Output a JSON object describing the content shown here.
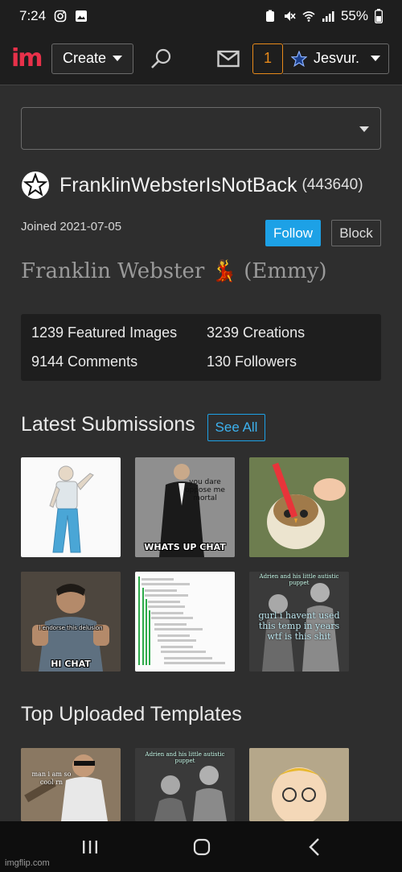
{
  "status_bar": {
    "time": "7:24",
    "battery": "55%"
  },
  "nav": {
    "logo": "im",
    "create_label": "Create",
    "notification_count": "1",
    "username": "Jesvur."
  },
  "profile": {
    "username": "FranklinWebsterIsNotBack",
    "user_id": "(443640)",
    "joined": "Joined 2021-07-05",
    "follow_label": "Follow",
    "block_label": "Block",
    "display_name": "Franklin Webster",
    "display_emoji": "💃",
    "display_suffix": "(Emmy)"
  },
  "stats": {
    "featured": "1239 Featured Images",
    "creations": "3239 Creations",
    "comments": "9144 Comments",
    "followers": "130 Followers"
  },
  "latest": {
    "title": "Latest Submissions",
    "see_all": "See All",
    "items": [
      {
        "caption": ""
      },
      {
        "caption": "WHATS UP CHAT",
        "top_text": "you dare oppose me mortal"
      },
      {
        "caption": ""
      },
      {
        "caption": "HI CHAT",
        "top_text": "i endorse this delusion"
      },
      {
        "caption": ""
      },
      {
        "caption": "gurl i havent used this temp in years wtf is this shit",
        "top_text": "Adrien and his little autistic puppet"
      }
    ]
  },
  "templates": {
    "title": "Top Uploaded Templates",
    "items": [
      {
        "caption": "man i am so cool rn"
      },
      {
        "caption": "Adrien and his little autistic puppet"
      },
      {
        "caption": ""
      }
    ]
  },
  "watermark": "imgflip.com",
  "colors": {
    "accent": "#1da1e6",
    "notification": "#e88a1a",
    "logo": "#e8314a",
    "background": "#2e2e2e"
  }
}
